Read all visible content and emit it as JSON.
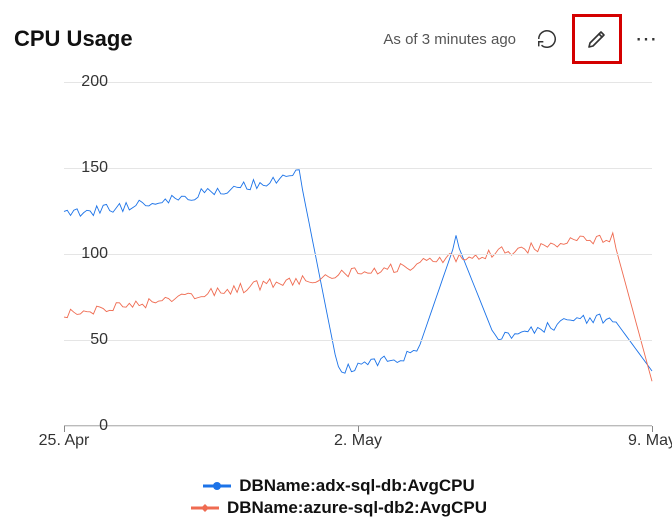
{
  "header": {
    "title": "CPU Usage",
    "timestamp": "As of 3 minutes ago"
  },
  "colors": {
    "series_a": "#1c73e8",
    "series_b": "#ef6b51",
    "edit_highlight": "#d40000"
  },
  "legend": [
    {
      "label": "DBName:adx-sql-db:AvgCPU",
      "color_key": "series_a"
    },
    {
      "label": "DBName:azure-sql-db2:AvgCPU",
      "color_key": "series_b"
    }
  ],
  "chart_data": {
    "type": "line",
    "title": "CPU Usage",
    "xlabel": "",
    "ylabel": "",
    "ylim": [
      0,
      200
    ],
    "y_ticks": [
      0,
      50,
      100,
      150,
      200
    ],
    "x_ticks": [
      "25. Apr",
      "2. May",
      "9. May"
    ],
    "x": [
      0,
      1,
      2,
      3,
      4,
      5,
      6,
      7,
      8,
      9,
      10,
      11,
      12,
      13,
      14,
      15
    ],
    "series": [
      {
        "name": "DBName:adx-sql-db:AvgCPU",
        "color": "#1c73e8",
        "values": [
          123,
          126,
          129,
          133,
          137,
          141,
          147,
          32,
          37,
          42,
          108,
          51,
          56,
          61,
          63,
          32
        ]
      },
      {
        "name": "DBName:azure-sql-db2:AvgCPU",
        "color": "#ef6b51",
        "values": [
          65,
          68,
          71,
          74,
          78,
          82,
          85,
          88,
          91,
          94,
          98,
          101,
          104,
          107,
          110,
          26
        ]
      }
    ]
  }
}
